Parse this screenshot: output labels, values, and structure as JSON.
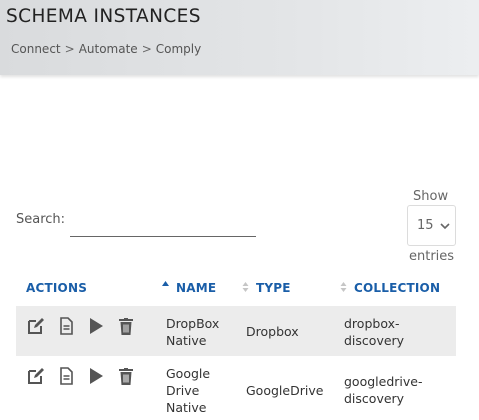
{
  "header": {
    "title": "SCHEMA INSTANCES",
    "breadcrumb": [
      {
        "label": "Connect"
      },
      {
        "label": "Automate"
      },
      {
        "label": "Comply"
      }
    ],
    "separator": ">"
  },
  "controls": {
    "show_label": "Show",
    "entries_value": "15",
    "entries_label": "entries",
    "search_label": "Search:",
    "search_value": ""
  },
  "table": {
    "columns": {
      "actions": "ACTIONS",
      "name": "NAME",
      "type": "TYPE",
      "collection": "COLLECTION"
    },
    "sorted_column": "name",
    "sort_direction": "ascending",
    "rows": [
      {
        "name": "DropBox Native",
        "name_lines": [
          "DropBox",
          "Native"
        ],
        "type": "Dropbox",
        "collection_lines": [
          "dropbox-",
          "discovery"
        ]
      },
      {
        "name": "Google Drive Native",
        "name_lines": [
          "Google",
          "Drive",
          "Native"
        ],
        "type": "GoogleDrive",
        "collection_lines": [
          "googledrive-",
          "discovery"
        ]
      }
    ],
    "row_actions": [
      "edit-icon",
      "document-icon",
      "play-icon",
      "trash-icon"
    ]
  },
  "colors": {
    "link": "#1a5ea8",
    "header_bg": "#e0e2e4",
    "row_shade": "#ececec",
    "icon": "#555555"
  }
}
